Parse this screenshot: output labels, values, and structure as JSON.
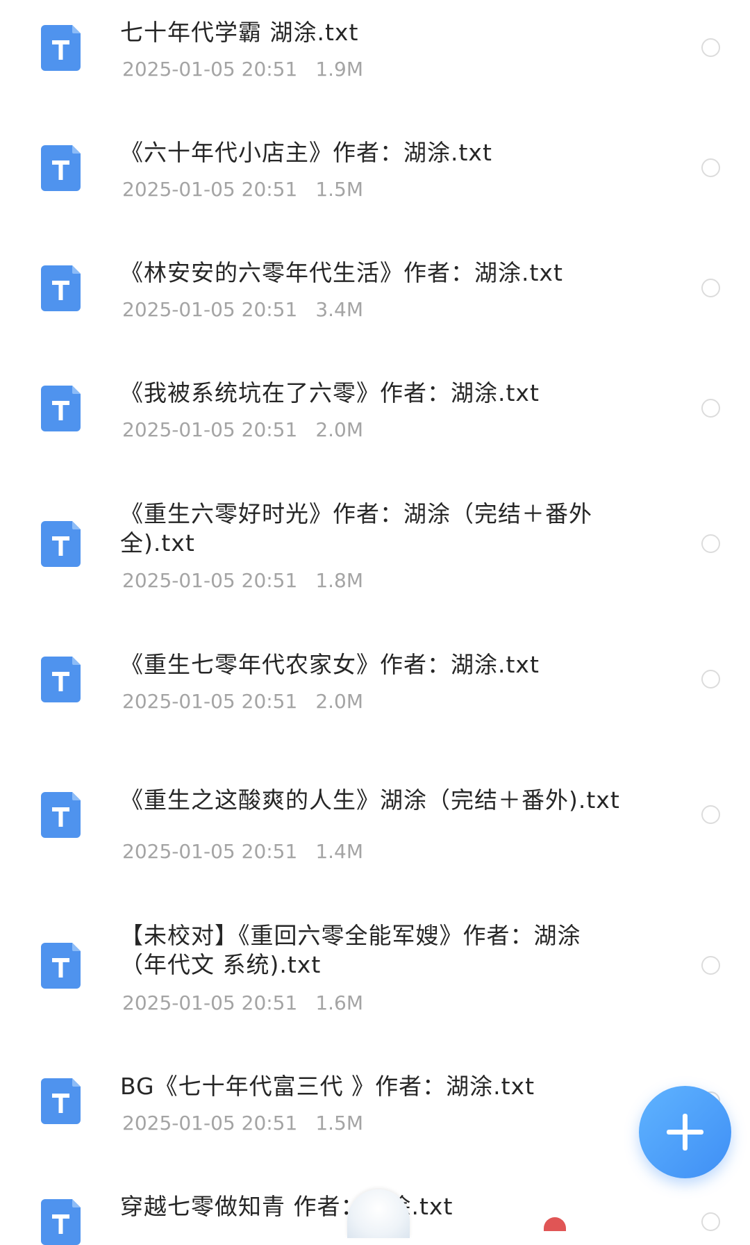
{
  "files": [
    {
      "title": "七十年代学霸 湖涂.txt",
      "date": "2025-01-05 20:51",
      "size": "1.9M",
      "selected": false
    },
    {
      "title": "《六十年代小店主》作者：湖涂.txt",
      "date": "2025-01-05 20:51",
      "size": "1.5M",
      "selected": false
    },
    {
      "title": "《林安安的六零年代生活》作者：湖涂.txt",
      "date": "2025-01-05 20:51",
      "size": "3.4M",
      "selected": false
    },
    {
      "title": "《我被系统坑在了六零》作者：湖涂.txt",
      "date": "2025-01-05 20:51",
      "size": "2.0M",
      "selected": false
    },
    {
      "title": "《重生六零好时光》作者：湖涂（完结＋番外全).txt",
      "date": "2025-01-05 20:51",
      "size": "1.8M",
      "selected": false
    },
    {
      "title": "《重生七零年代农家女》作者：湖涂.txt",
      "date": "2025-01-05 20:51",
      "size": "2.0M",
      "selected": false
    },
    {
      "title": "《重生之这酸爽的人生》湖涂（完结＋番外).txt",
      "date": "2025-01-05 20:51",
      "size": "1.4M",
      "selected": false
    },
    {
      "title": "【未校对】《重回六零全能军嫂》作者：湖涂（年代文 系统).txt",
      "date": "2025-01-05 20:51",
      "size": "1.6M",
      "selected": false
    },
    {
      "title": "BG《七十年代富三代 》作者：湖涂.txt",
      "date": "2025-01-05 20:51",
      "size": "1.5M",
      "selected": false
    },
    {
      "title": "穿越七零做知青 作者：湖涂.txt",
      "date": "",
      "size": "",
      "selected": false
    }
  ],
  "icons": {
    "file_type_icon": "txt-document-icon",
    "fab_icon": "plus-icon"
  },
  "colors": {
    "accent": "#4a90f0",
    "file_icon": "#4f93ee",
    "title_text": "#262626",
    "meta_text": "#a4a4a4",
    "radio_border": "#dcdcdc"
  }
}
